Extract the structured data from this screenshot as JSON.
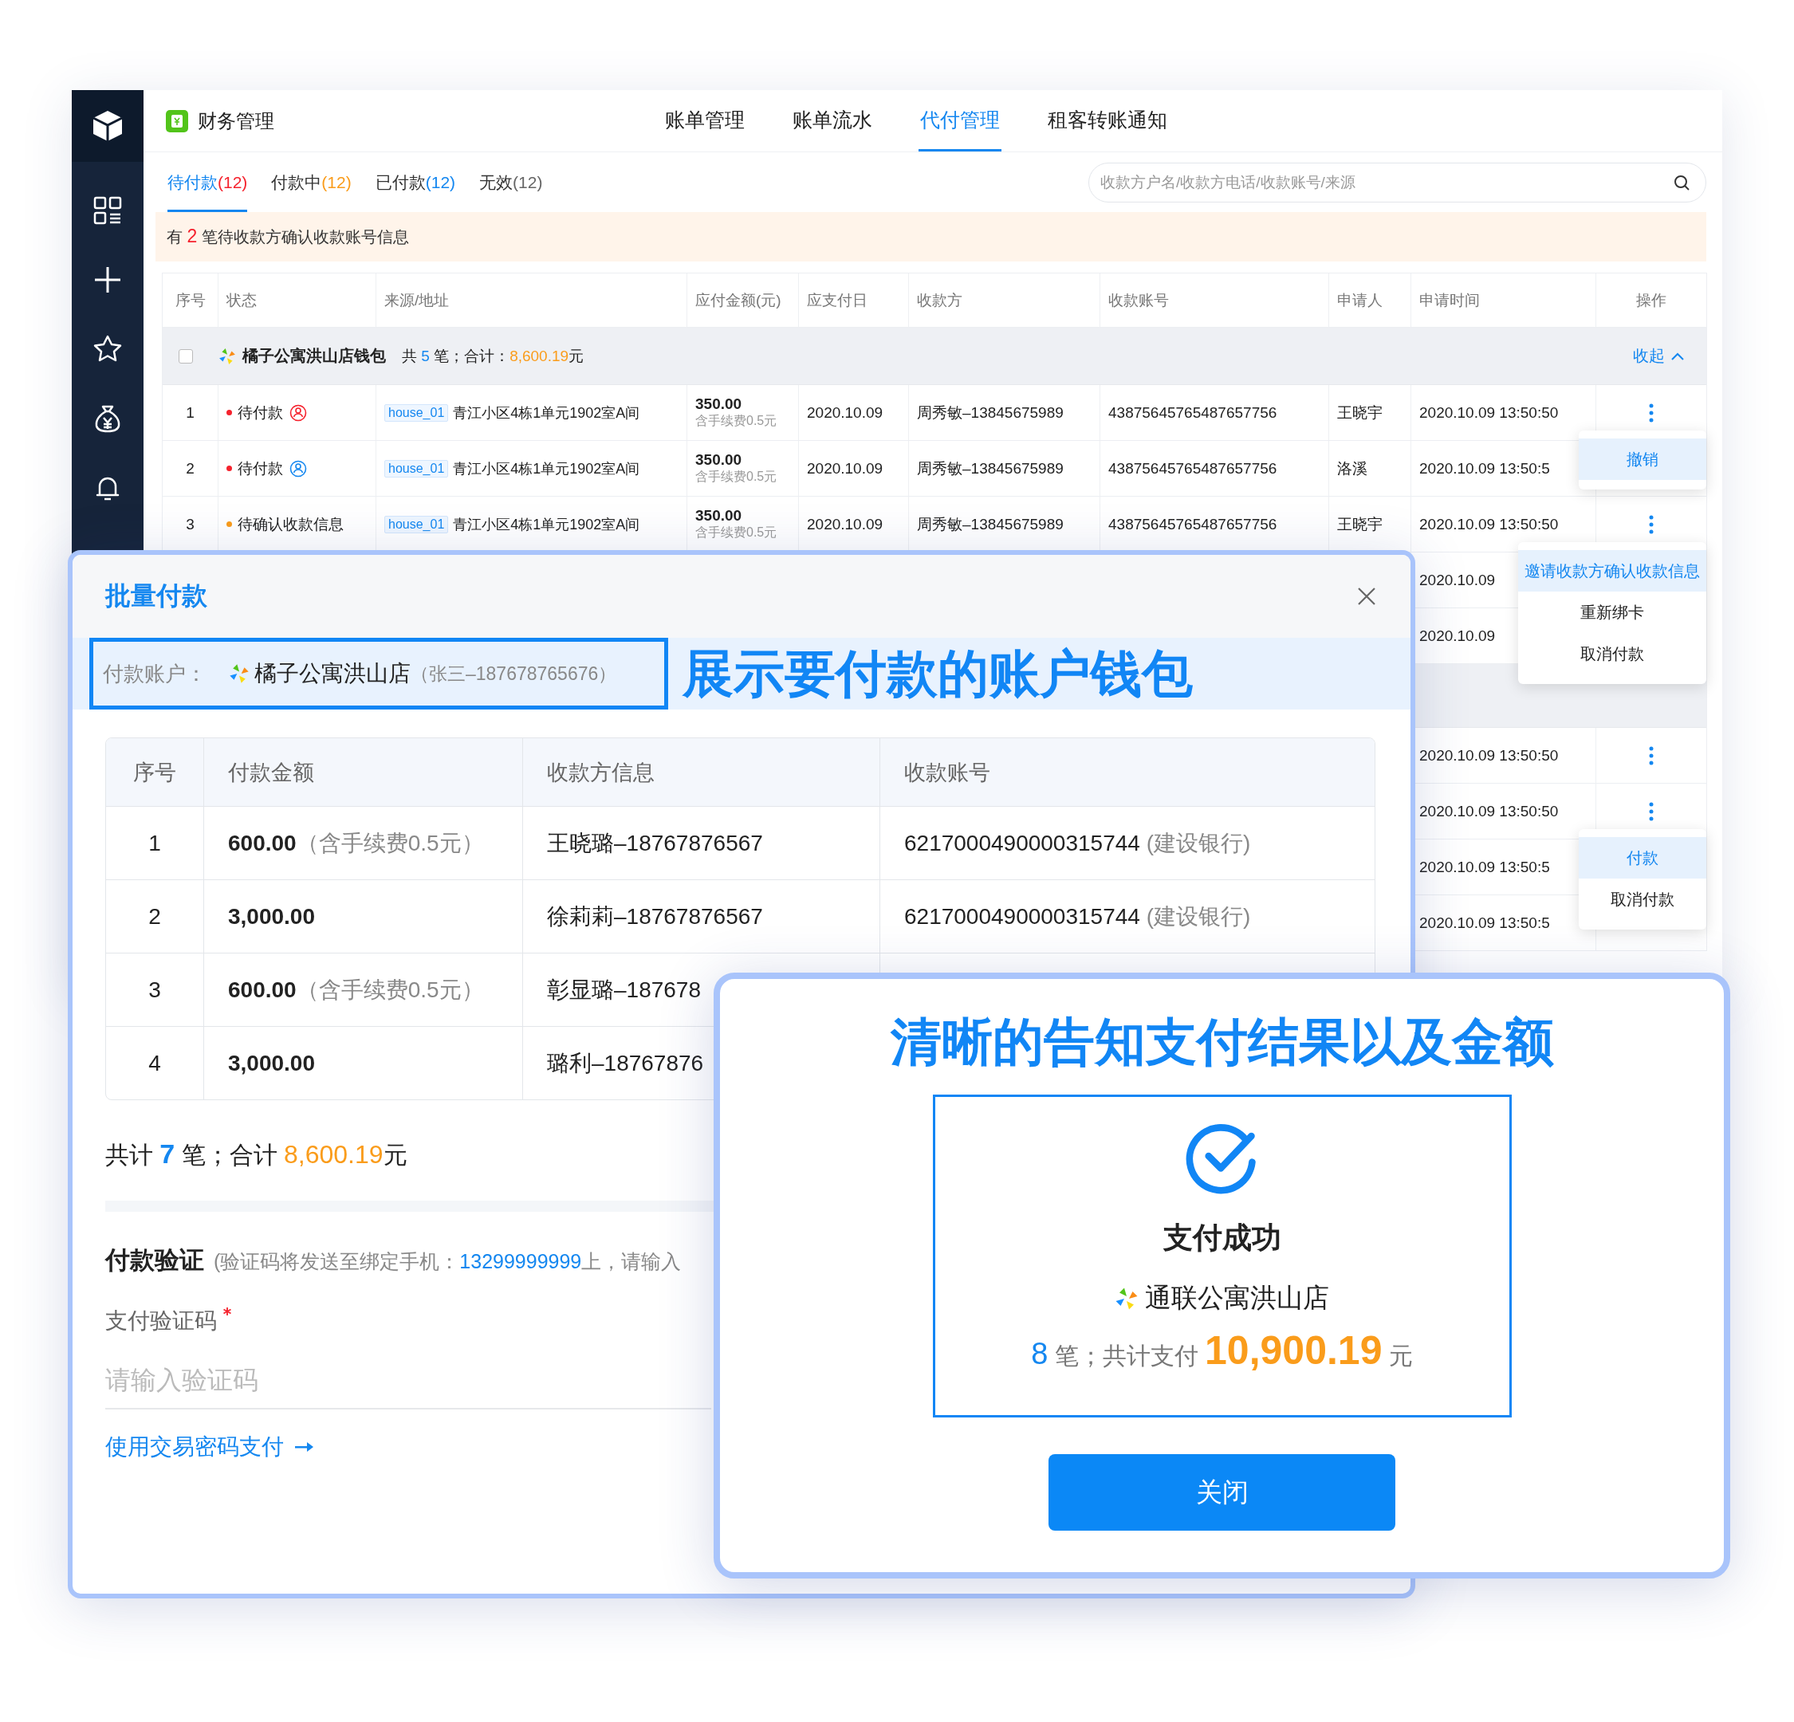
{
  "header": {
    "app_title": "财务管理",
    "nav": [
      {
        "label": "账单管理",
        "selected": false
      },
      {
        "label": "账单流水",
        "selected": false
      },
      {
        "label": "代付管理",
        "selected": true
      },
      {
        "label": "租客转账通知",
        "selected": false
      }
    ]
  },
  "tabs": [
    {
      "label": "待付款",
      "count": "(12)",
      "color": "#f5222d",
      "selected": true
    },
    {
      "label": "付款中",
      "count": "(12)",
      "color": "#fa9c1b",
      "selected": false
    },
    {
      "label": "已付款",
      "count": "(12)",
      "color": "#1487f0",
      "selected": false
    },
    {
      "label": "无效",
      "count": "(12)",
      "color": "#666666",
      "selected": false
    }
  ],
  "search": {
    "placeholder": "收款方户名/收款方电话/收款账号/来源"
  },
  "notice": [
    {
      "kind": "plain",
      "text": "有 "
    },
    {
      "kind": "alert",
      "text": "2"
    },
    {
      "kind": "plain",
      "text": " 笔待收款方确认收款账号信息"
    }
  ],
  "table": {
    "columns": [
      "序号",
      "状态",
      "来源/地址",
      "应付金额(元)",
      "应支付日",
      "收款方",
      "收款账号",
      "申请人",
      "申请时间",
      "操作"
    ],
    "rows": [
      {
        "kind": "group",
        "checked": false,
        "name": "橘子公寓洪山店钱包",
        "summary": [
          {
            "kind": "plain",
            "text": "共 "
          },
          {
            "kind": "count",
            "text": "5"
          },
          {
            "kind": "plain",
            "text": " 笔；合计："
          },
          {
            "kind": "amount",
            "text": "8,600.19"
          },
          {
            "kind": "plain",
            "text": "元"
          }
        ],
        "toggle": "收起"
      },
      {
        "kind": "item",
        "index": "1",
        "status": "待付款",
        "color": "#f5222d",
        "badge": {
          "color": "#f5222d"
        },
        "source_tag": "house_01",
        "address": "青江小区4栋1单元1902室A间",
        "amount": "350.00",
        "fee": "含手续费0.5元",
        "due": "2020.10.09",
        "payee": "周秀敏–13845675989",
        "account": "43875645765487657756",
        "applicant": "王晓宇",
        "time": "2020.10.09 13:50:50",
        "more": true,
        "menu": [
          {
            "label": "撤销",
            "selected": true
          }
        ]
      },
      {
        "kind": "item",
        "index": "2",
        "status": "待付款",
        "color": "#f5222d",
        "badge": {
          "color": "#1487f0"
        },
        "source_tag": "house_01",
        "address": "青江小区4栋1单元1902室A间",
        "amount": "350.00",
        "fee": "含手续费0.5元",
        "due": "2020.10.09",
        "payee": "周秀敏–13845675989",
        "account": "43875645765487657756",
        "applicant": "洛溪",
        "time": "2020.10.09 13:50:5"
      },
      {
        "kind": "item",
        "index": "3",
        "status": "待确认收款信息",
        "color": "#fa9c1b",
        "source_tag": "house_01",
        "address": "青江小区4栋1单元1902室A间",
        "amount": "350.00",
        "fee": "含手续费0.5元",
        "due": "2020.10.09",
        "payee": "周秀敏–13845675989",
        "account": "43875645765487657756",
        "applicant": "王晓宇",
        "time": "2020.10.09 13:50:50",
        "more": true,
        "menu": [
          {
            "label": "邀请收款方确认收款信息",
            "selected": true
          },
          {
            "label": "重新绑卡",
            "selected": false
          },
          {
            "label": "取消付款",
            "selected": false
          }
        ]
      },
      {
        "kind": "partial",
        "time": "2020.10.09"
      },
      {
        "kind": "partial",
        "time": "2020.10.09"
      },
      {
        "kind": "band"
      },
      {
        "kind": "partial",
        "time": "2020.10.09 13:50:50",
        "more": true
      },
      {
        "kind": "partial",
        "time": "2020.10.09 13:50:50",
        "more": true,
        "menu": [
          {
            "label": "付款",
            "selected": true
          },
          {
            "label": "取消付款",
            "selected": false
          }
        ]
      },
      {
        "kind": "partial",
        "time": "2020.10.09 13:50:5"
      },
      {
        "kind": "partial",
        "time": "2020.10.09 13:50:5"
      }
    ]
  },
  "batch_dialog": {
    "title": "批量付款",
    "account_label": "付款账户：",
    "account_name": "橘子公寓洪山店",
    "account_owner": "（张三–187678765676）",
    "annotation": "展示要付款的账户钱包",
    "table": {
      "columns": [
        "序号",
        "付款金额",
        "收款方信息",
        "收款账号"
      ],
      "rows": [
        {
          "index": "1",
          "amount": "600.00",
          "fee": "（含手续费0.5元）",
          "payee": "王晓璐–18767876567",
          "account": "6217000490000315744",
          "bank": "(建设银行)"
        },
        {
          "index": "2",
          "amount": "3,000.00",
          "payee": "徐莉莉–18767876567",
          "account": "6217000490000315744",
          "bank": "(建设银行)"
        },
        {
          "index": "3",
          "amount": "600.00",
          "fee": "（含手续费0.5元）",
          "payee": "彰显璐–187678"
        },
        {
          "index": "4",
          "amount": "3,000.00",
          "payee": "璐利–18767876"
        }
      ]
    },
    "summary": [
      {
        "kind": "plain",
        "text": "共计 "
      },
      {
        "kind": "count",
        "text": "7"
      },
      {
        "kind": "plain",
        "text": " 笔；合计 "
      },
      {
        "kind": "amount",
        "text": "8,600.19"
      },
      {
        "kind": "plain",
        "text": "元"
      }
    ],
    "verify_title": "付款验证",
    "verify_note": [
      {
        "kind": "plain",
        "text": "(验证码将发送至绑定手机："
      },
      {
        "kind": "count",
        "text": "13299999999"
      },
      {
        "kind": "plain",
        "text": "上，请输入"
      }
    ],
    "code_label": "支付验证码",
    "code_required": true,
    "code_placeholder": "请输入验证码",
    "password_link": "使用交易密码支付"
  },
  "success_dialog": {
    "annotation": "清晰的告知支付结果以及金额",
    "status": "支付成功",
    "store": "通联公寓洪山店",
    "result": [
      {
        "kind": "count",
        "text": "8"
      },
      {
        "kind": "plain",
        "text": " 笔；共计支付 "
      },
      {
        "kind": "amount",
        "text": "10,900.19"
      },
      {
        "kind": "plain",
        "text": " 元"
      }
    ],
    "button": "关闭"
  }
}
